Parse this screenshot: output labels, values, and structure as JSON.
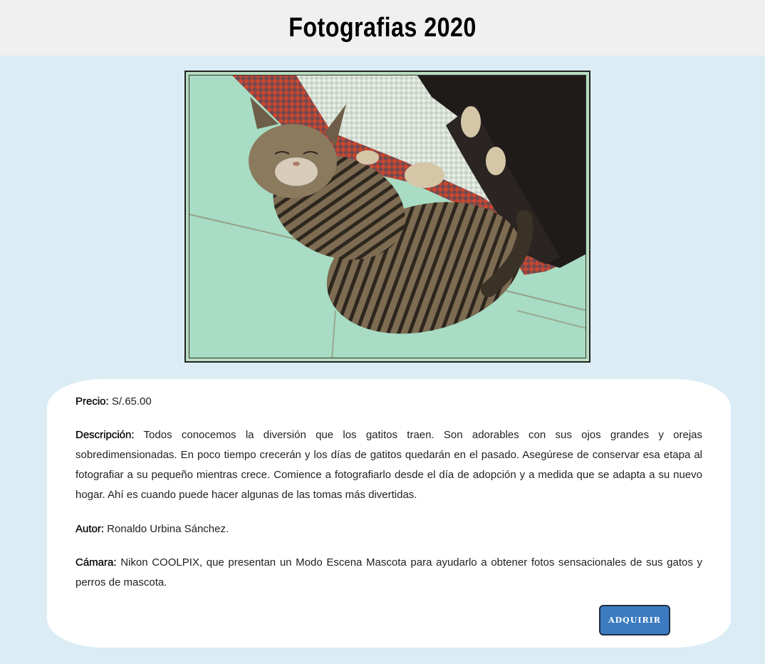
{
  "header": {
    "title": "Fotografias 2020"
  },
  "photo": {
    "subject": "sleeping tabby kitten on green tile floor"
  },
  "product": {
    "price_label": "Precio:",
    "price_value": "S/.65.00",
    "description_label": "Descripción:",
    "description_value": "Todos conocemos la diversión que los gatitos traen. Son adorables con sus ojos grandes y orejas sobredimensionadas. En poco tiempo crecerán y los días de gatitos quedarán en el pasado. Asegúrese de conservar esa etapa al fotografiar a su pequeño mientras crece. Comience a fotografiarlo desde el día de adopción y a medida que se adapta a su nuevo hogar. Ahí es cuando puede hacer algunas de las tomas más divertidas.",
    "author_label": "Autor:",
    "author_value": "Ronaldo Urbina Sánchez.",
    "camera_label": "Cámara:",
    "camera_value": "Nikon COOLPIX, que presentan un Modo Escena Mascota para ayudarlo a obtener fotos sensacionales de sus gatos y perros de mascota."
  },
  "actions": {
    "buy_label": "ADQUIRIR"
  },
  "colors": {
    "background": "#dbecf5",
    "header_bg": "#f0f0f0",
    "button_bg": "#3b7bbf"
  }
}
